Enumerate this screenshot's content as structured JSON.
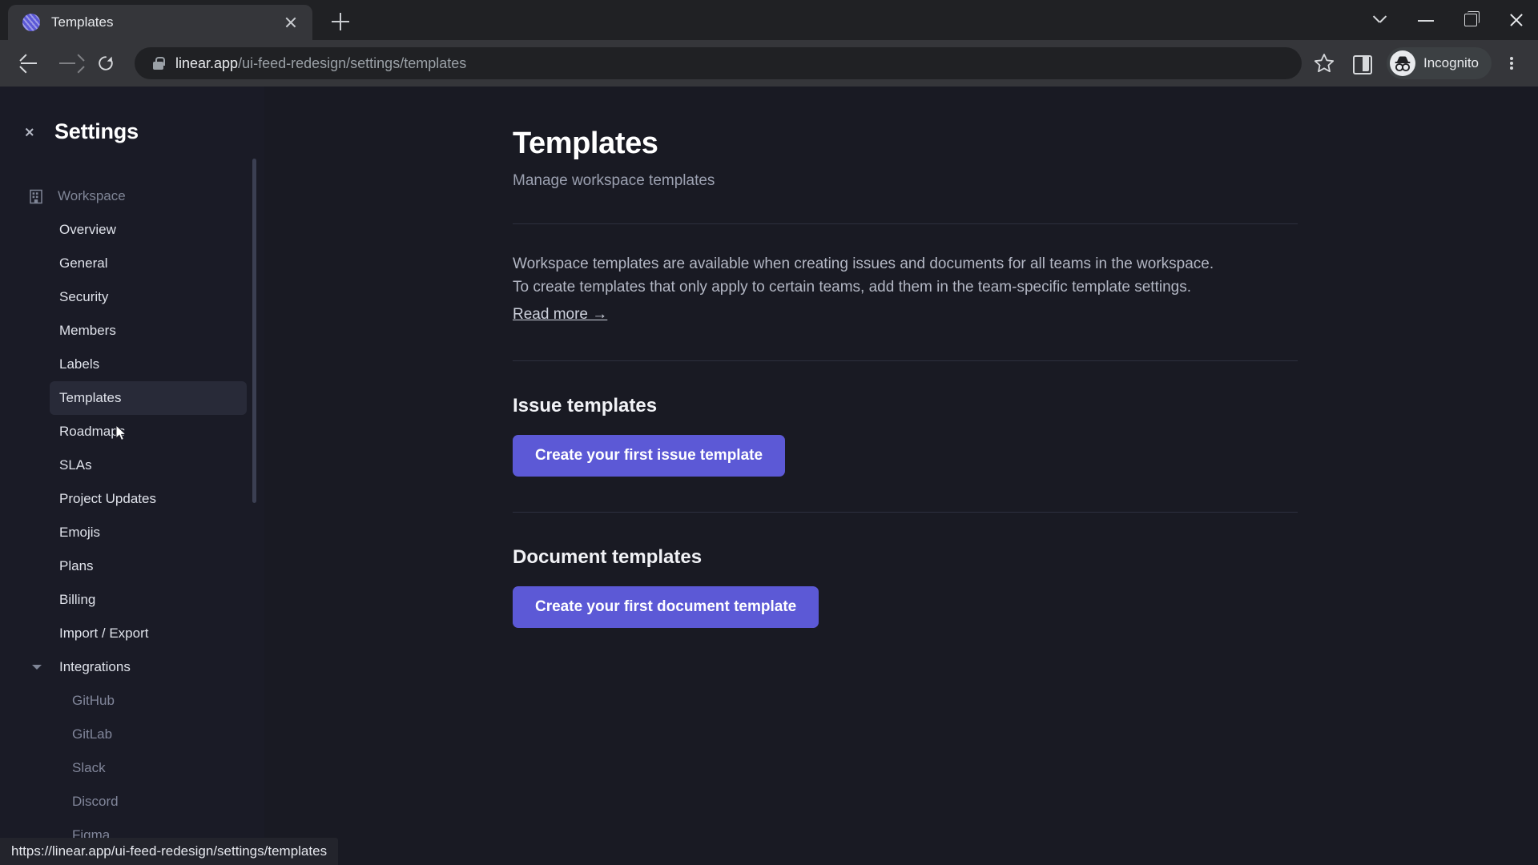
{
  "browser": {
    "tab": {
      "title": "Templates",
      "favicon": "linear-logo-icon"
    },
    "newtab_label": "+",
    "window_controls": [
      "chevron-down-icon",
      "minimize-icon",
      "maximize-icon",
      "close-icon"
    ],
    "nav": {
      "back": "back-arrow-icon",
      "forward": "forward-arrow-icon",
      "reload": "reload-icon"
    },
    "omnibox": {
      "lock": "lock-icon",
      "host": "linear.app",
      "path": "/ui-feed-redesign/settings/templates",
      "full_url": "linear.app/ui-feed-redesign/settings/templates",
      "bookmark": "star-icon"
    },
    "toolbar_right": {
      "side_panel": "side-panel-icon",
      "profile_label": "Incognito",
      "profile_avatar": "incognito-avatar-icon",
      "menu": "kebab-menu-icon"
    },
    "status_bar": {
      "url": "https://linear.app/ui-feed-redesign/settings/templates"
    }
  },
  "sidebar": {
    "back_icon": "chevron-left-icon",
    "title": "Settings",
    "group": {
      "icon": "building-icon",
      "label": "Workspace"
    },
    "items": [
      {
        "label": "Overview",
        "active": false,
        "sub": false
      },
      {
        "label": "General",
        "active": false,
        "sub": false
      },
      {
        "label": "Security",
        "active": false,
        "sub": false
      },
      {
        "label": "Members",
        "active": false,
        "sub": false
      },
      {
        "label": "Labels",
        "active": false,
        "sub": false
      },
      {
        "label": "Templates",
        "active": true,
        "sub": false
      },
      {
        "label": "Roadmaps",
        "active": false,
        "sub": false
      },
      {
        "label": "SLAs",
        "active": false,
        "sub": false
      },
      {
        "label": "Project Updates",
        "active": false,
        "sub": false
      },
      {
        "label": "Emojis",
        "active": false,
        "sub": false
      },
      {
        "label": "Plans",
        "active": false,
        "sub": false
      },
      {
        "label": "Billing",
        "active": false,
        "sub": false
      },
      {
        "label": "Import / Export",
        "active": false,
        "sub": false
      }
    ],
    "integrations": {
      "label": "Integrations",
      "caret": "caret-down-icon",
      "children": [
        "GitHub",
        "GitLab",
        "Slack",
        "Discord",
        "Figma"
      ]
    }
  },
  "main": {
    "title": "Templates",
    "subtitle": "Manage workspace templates",
    "description_line1": "Workspace templates are available when creating issues and documents for all teams in the workspace.",
    "description_line2": "To create templates that only apply to certain teams, add them in the team-specific template settings.",
    "read_more": "Read more →",
    "issue_section": {
      "title": "Issue templates",
      "button": "Create your first issue template"
    },
    "document_section": {
      "title": "Document templates",
      "button": "Create your first document template"
    }
  },
  "colors": {
    "accent": "#5c59d6",
    "app_bg": "#191a23",
    "sidebar_bg": "#1a1b26",
    "chrome_bg": "#35363a"
  }
}
